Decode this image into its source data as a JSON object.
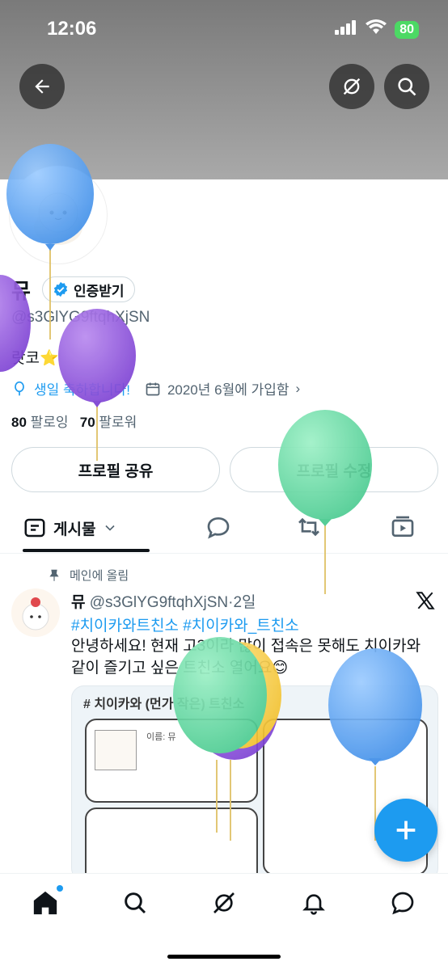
{
  "status_bar": {
    "time": "12:06",
    "battery": "80"
  },
  "profile": {
    "name": "뮤",
    "verify_label": "인증받기",
    "handle": "@s3GlYG9ftqhXjSN",
    "bio": "랏코⭐",
    "birthday": "생일 축하합니다!",
    "joined": "2020년 6월에 가입함",
    "following_count": "80",
    "following_label": "팔로잉",
    "followers_count": "70",
    "followers_label": "팔로워",
    "share_button": "프로필 공유",
    "edit_button": "프로필 수정"
  },
  "tabs": {
    "posts_label": "게시물"
  },
  "pinned_post": {
    "pinned_label": "메인에 올림",
    "author": "뮤",
    "handle": "@s3GlYG9ftqhXjSN",
    "separator": "·",
    "time": "2일",
    "hashtags": "#치이카와트친소 #치이카와_트친소",
    "text": "안녕하세요! 현재 고3이라 많이 접속은 못해도 치이카와 같이 즐기고 싶은 트친소 열어요😊",
    "image_title": "# 치이카와 (먼가 작은) 트친소",
    "image_name_field": "이름: 뮤"
  },
  "colors": {
    "accent": "#1d9bf0",
    "verified": "#1d9bf0"
  }
}
